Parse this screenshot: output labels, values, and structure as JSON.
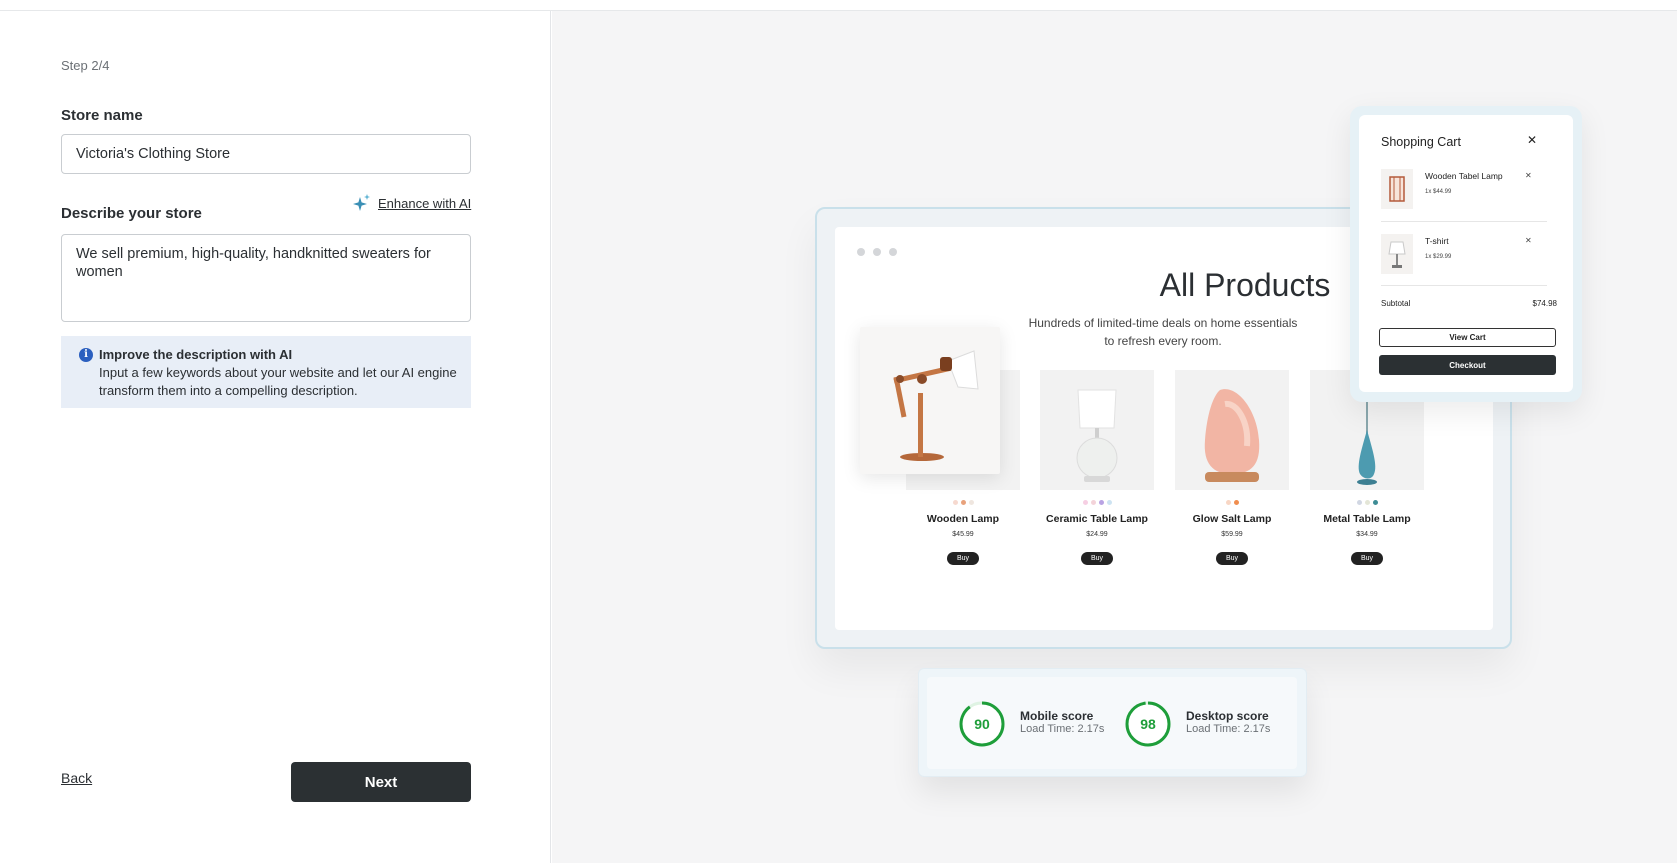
{
  "form": {
    "step": "Step 2/4",
    "store_name_label": "Store name",
    "store_name_value": "Victoria's Clothing Store",
    "describe_label": "Describe your store",
    "enhance_label": "Enhance with AI",
    "description_value": "We sell premium, high-quality, handknitted sweaters for women",
    "info_title": "Improve the description with AI",
    "info_text": "Input a few keywords about your website and let our AI engine transform them into a compelling description.",
    "back_label": "Back",
    "next_label": "Next"
  },
  "preview": {
    "title": "All Products",
    "subtitle": "Hundreds of limited-time deals on home essentials to refresh every room.",
    "buy_label": "Buy",
    "products": [
      {
        "name": "Wooden Lamp",
        "price": "$45.99",
        "swatches": [
          "#f6d9cf",
          "#e8a27c",
          "#efe6df"
        ]
      },
      {
        "name": "Ceramic Table Lamp",
        "price": "$24.99",
        "swatches": [
          "#f6cfe3",
          "#f3d3d9",
          "#b9a3e3",
          "#cde3f2"
        ]
      },
      {
        "name": "Glow Salt Lamp",
        "price": "$59.99",
        "swatches": [
          "#f8d6c4",
          "#f08e4f"
        ]
      },
      {
        "name": "Metal Table Lamp",
        "price": "$34.99",
        "swatches": [
          "#d1d7e3",
          "#e4e6d7",
          "#3e8c95"
        ]
      }
    ]
  },
  "cart": {
    "title": "Shopping Cart",
    "items": [
      {
        "name": "Wooden Tabel Lamp",
        "qty": "1x $44.99"
      },
      {
        "name": "T-shirt",
        "qty": "1x $29.99"
      }
    ],
    "subtotal_label": "Subtotal",
    "subtotal_value": "$74.98",
    "view_cart_label": "View Cart",
    "checkout_label": "Checkout"
  },
  "scores": {
    "mobile": {
      "value": "90",
      "label": "Mobile score",
      "load": "Load Time: 2.17s"
    },
    "desktop": {
      "value": "98",
      "label": "Desktop score",
      "load": "Load Time: 2.17s"
    }
  },
  "colors": {
    "accent_dark": "#2b3033",
    "info_bg": "#e8eef7",
    "score_green": "#1e9e3a"
  }
}
